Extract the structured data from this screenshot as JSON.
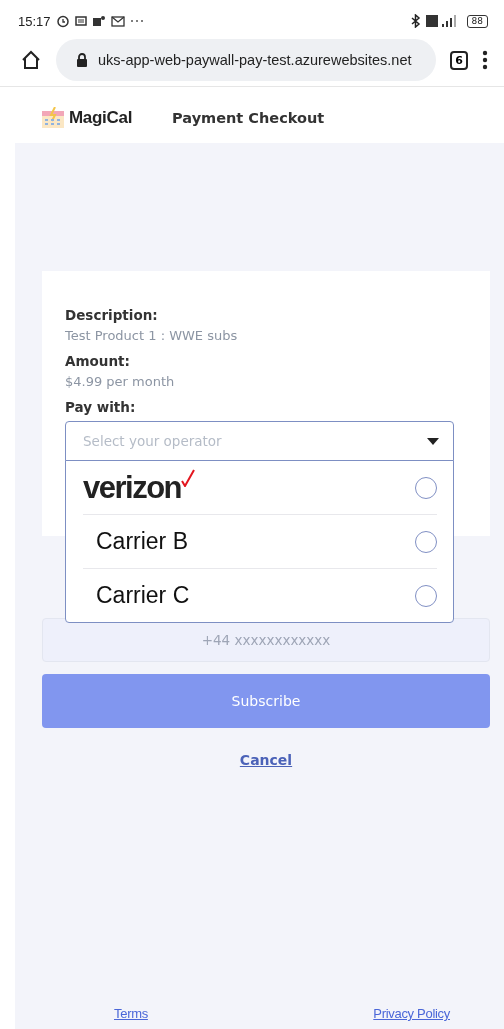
{
  "status_bar": {
    "time": "15:17",
    "battery": "88"
  },
  "browser": {
    "url": "uks-app-web-paywall-pay-test.azurewebsites.net",
    "tab_count": "6"
  },
  "header": {
    "brand": "MagiCal",
    "title": "Payment Checkout"
  },
  "form": {
    "description_label": "Description:",
    "description": "Test Product 1 : WWE subs",
    "amount_label": "Amount:",
    "amount": "$4.99 per month",
    "pay_label": "Pay with:",
    "operator_select": {
      "placeholder": "Select your operator",
      "expanded": true,
      "options": [
        {
          "kind": "logo",
          "label": "verizon",
          "selected": false
        },
        {
          "kind": "text",
          "label": "Carrier B",
          "selected": false
        },
        {
          "kind": "text",
          "label": "Carrier C",
          "selected": false
        }
      ]
    },
    "phone": {
      "placeholder": "+44 xxxxxxxxxxxx"
    },
    "subscribe": {
      "label": "Subscribe",
      "disabled": true
    },
    "cancel": "Cancel"
  },
  "footer": {
    "links": [
      "Terms",
      "Privacy Policy"
    ]
  }
}
